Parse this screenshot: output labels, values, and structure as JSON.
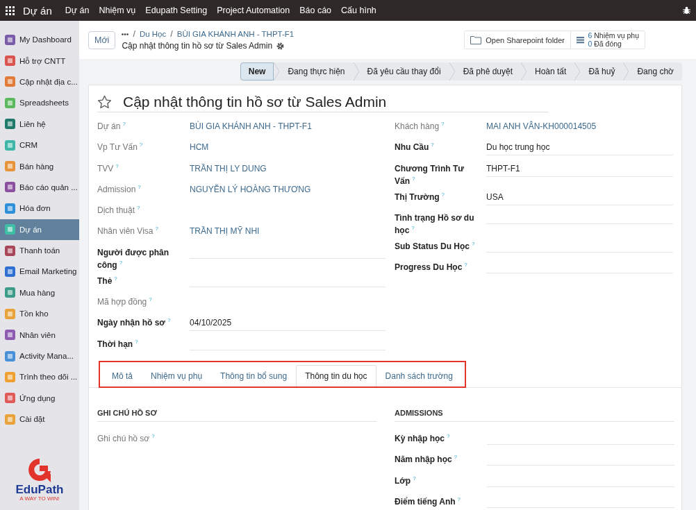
{
  "navbar": {
    "brand": "Dự án",
    "menu": [
      "Dự án",
      "Nhiệm vụ",
      "Edupath Setting",
      "Project Automation",
      "Báo cáo",
      "Cấu hình"
    ]
  },
  "sidebar": {
    "items": [
      {
        "label": "My Dashboard",
        "color": "#7b5ca8",
        "selected": false
      },
      {
        "label": "Hỗ trợ CNTT",
        "color": "#d9534f",
        "selected": false
      },
      {
        "label": "Cập nhật địa c...",
        "color": "#e07b39",
        "selected": false
      },
      {
        "label": "Spreadsheets",
        "color": "#5cb85c",
        "selected": false
      },
      {
        "label": "Liên hệ",
        "color": "#1f7a6b",
        "selected": false
      },
      {
        "label": "CRM",
        "color": "#3fb6a8",
        "selected": false
      },
      {
        "label": "Bán hàng",
        "color": "#e8943a",
        "selected": false
      },
      {
        "label": "Báo cáo quản ...",
        "color": "#8a4f9e",
        "selected": false
      },
      {
        "label": "Hóa đơn",
        "color": "#2f8fd8",
        "selected": false
      },
      {
        "label": "Dự án",
        "color": "#3fbfa5",
        "selected": true
      },
      {
        "label": "Thanh toán",
        "color": "#a8475a",
        "selected": false
      },
      {
        "label": "Email Marketing",
        "color": "#2e6fd1",
        "selected": false
      },
      {
        "label": "Mua hàng",
        "color": "#3d9b8a",
        "selected": false
      },
      {
        "label": "Tồn kho",
        "color": "#e8a33a",
        "selected": false
      },
      {
        "label": "Nhân viên",
        "color": "#8e5bb0",
        "selected": false
      },
      {
        "label": "Activity Mana...",
        "color": "#4a90d9",
        "selected": false
      },
      {
        "label": "Trình theo dõi ...",
        "color": "#f0a030",
        "selected": false
      },
      {
        "label": "Ứng dụng",
        "color": "#e05a5a",
        "selected": false
      },
      {
        "label": "Cài đặt",
        "color": "#e8a33a",
        "selected": false
      }
    ],
    "logo": {
      "name": "EduPath",
      "tagline": "A WAY TO WIN!"
    }
  },
  "control_panel": {
    "new_button": "Mới",
    "breadcrumbs": [
      {
        "separator": "/",
        "label": "Du Học"
      },
      {
        "separator": "/",
        "label": "BÙI GIA KHÁNH ANH - THPT-F1"
      }
    ],
    "record_title": "Cập nhật thông tin hồ sơ từ Sales Admin",
    "sharepoint_button": "Open Sharepoint folder",
    "subtasks": {
      "count": "6",
      "label": "Nhiệm vụ phụ",
      "closed_count": "0",
      "closed_label": "Đã đóng"
    }
  },
  "stages": [
    {
      "label": "New",
      "selected": true
    },
    {
      "label": "Đang thực hiện",
      "selected": false
    },
    {
      "label": "Đã yêu cầu thay đổi",
      "selected": false
    },
    {
      "label": "Đã phê duyệt",
      "selected": false
    },
    {
      "label": "Hoàn tất",
      "selected": false
    },
    {
      "label": "Đã huỷ",
      "selected": false
    },
    {
      "label": "Đang chờ",
      "selected": false
    }
  ],
  "form": {
    "title": "Cập nhật thông tin hồ sơ từ Sales Admin",
    "starred": false,
    "left_fields": [
      {
        "label": "Dự án",
        "help": "?",
        "editable": false,
        "kind": "link",
        "value": "BÙI GIA KHÁNH ANH - THPT-F1"
      },
      {
        "label": "Vp Tư Vấn",
        "help": "?",
        "editable": false,
        "kind": "link",
        "value": "HCM"
      },
      {
        "label": "TVV",
        "help": "?",
        "editable": false,
        "kind": "link",
        "value": "TRẦN THỊ LY DUNG"
      },
      {
        "label": "Admission",
        "help": "?",
        "editable": false,
        "kind": "link",
        "value": "NGUYỄN LÝ HOÀNG THƯƠNG"
      },
      {
        "label": "Dịch thuật",
        "help": "?",
        "editable": false
      },
      {
        "label": "Nhân viên Visa",
        "help": "?",
        "editable": false,
        "kind": "link",
        "value": "TRẦN THỊ MỸ NHI"
      },
      {
        "label": "Người được phân công",
        "help": "?",
        "editable": true
      },
      {
        "label": "Thẻ",
        "help": "?",
        "editable": true
      },
      {
        "label": "Mã hợp đồng",
        "help": "?",
        "editable": false
      },
      {
        "label": "Ngày nhận hồ sơ",
        "help": "?",
        "editable": true,
        "kind": "text",
        "value": "04/10/2025"
      },
      {
        "label": "Thời hạn",
        "help": "?",
        "editable": true
      }
    ],
    "right_fields": [
      {
        "label": "Khách hàng",
        "help": "?",
        "editable": false,
        "kind": "link",
        "value": "MAI ANH VÂN-KH000014505"
      },
      {
        "label": "Nhu Cầu",
        "help": "?",
        "editable": true,
        "kind": "text",
        "value": "Du học trung học"
      },
      {
        "label": "Chương Trình Tư Vấn",
        "help": "?",
        "editable": true,
        "kind": "text",
        "value": "THPT-F1"
      },
      {
        "label": "Thị Trường",
        "help": "?",
        "editable": true,
        "kind": "text",
        "value": "USA"
      },
      {
        "label": "Tình trạng Hồ sơ du học",
        "help": "?",
        "editable": true
      },
      {
        "label": "Sub Status Du Học",
        "help": "?",
        "editable": true
      },
      {
        "label": "Progress Du Học",
        "help": "?",
        "editable": true
      }
    ]
  },
  "tabs_highlighted": true,
  "tabs": [
    {
      "label": "Mô tả",
      "selected": false
    },
    {
      "label": "Nhiệm vụ phụ",
      "selected": false
    },
    {
      "label": "Thông tin bổ sung",
      "selected": false
    },
    {
      "label": "Thông tin du học",
      "selected": true
    },
    {
      "label": "Danh sách trường",
      "selected": false
    }
  ],
  "sections": [
    {
      "title": "GHI CHÚ HỒ SƠ",
      "fields": [
        {
          "label": "Ghi chú hồ sơ",
          "help": "?",
          "editable": false
        }
      ]
    },
    {
      "title": "ADMISSIONS",
      "fields": [
        {
          "label": "Kỳ nhập học",
          "help": "?",
          "editable": true
        },
        {
          "label": "Năm nhập học",
          "help": "?",
          "editable": true
        },
        {
          "label": "Lớp",
          "help": "?",
          "editable": true
        },
        {
          "label": "Điểm tiếng Anh",
          "help": "?",
          "editable": true
        }
      ]
    }
  ]
}
